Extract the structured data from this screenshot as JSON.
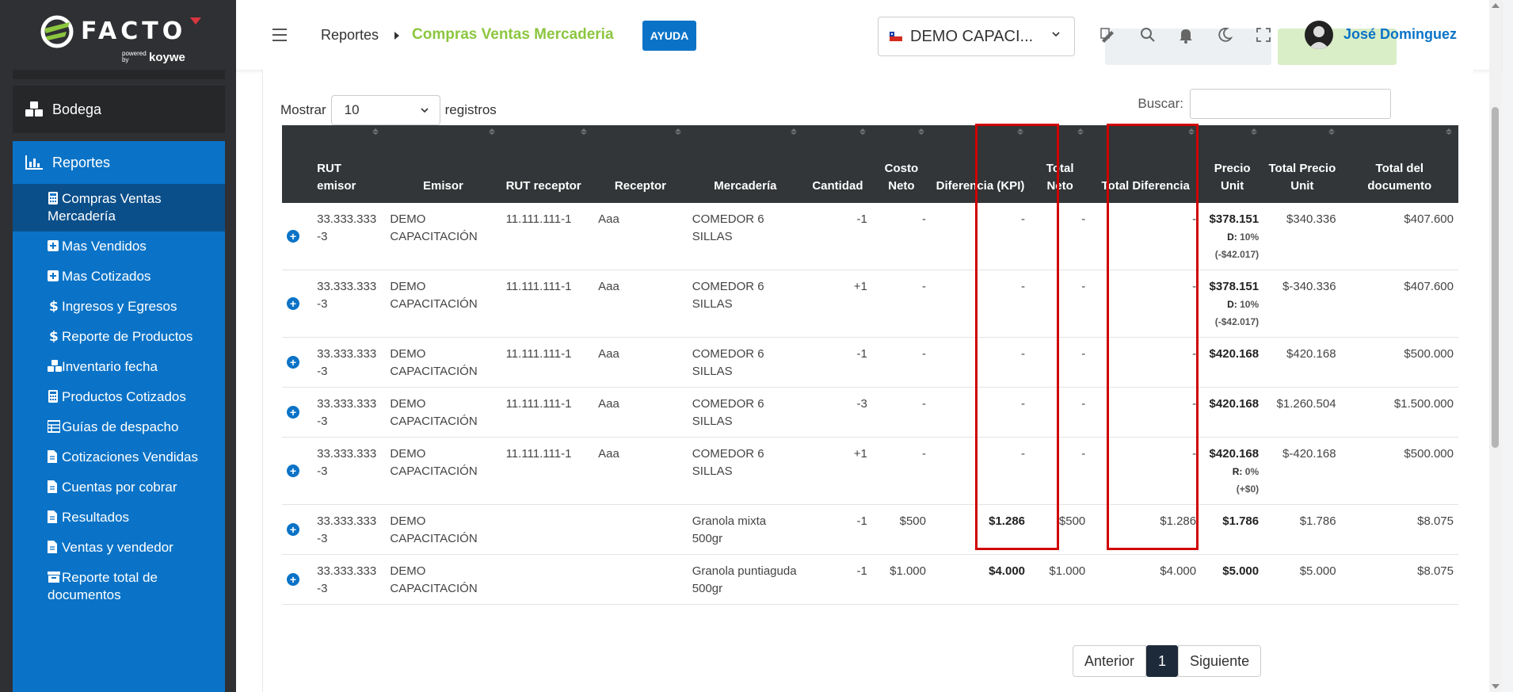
{
  "brand": {
    "name": "FACTO",
    "powered": "powered by",
    "partner": "koywe"
  },
  "sidebar": {
    "bodega": "Bodega",
    "section": "Reportes",
    "items": [
      {
        "label": "Compras Ventas Mercadería",
        "icon": "calculator-icon"
      },
      {
        "label": "Mas Vendidos",
        "icon": "plus-square-icon"
      },
      {
        "label": "Mas Cotizados",
        "icon": "plus-square-icon"
      },
      {
        "label": "Ingresos y Egresos",
        "icon": "dollar-icon"
      },
      {
        "label": "Reporte de Productos",
        "icon": "dollar-icon"
      },
      {
        "label": "Inventario fecha",
        "icon": "cubes-icon"
      },
      {
        "label": "Productos Cotizados",
        "icon": "calculator-icon"
      },
      {
        "label": "Guías de despacho",
        "icon": "table-icon"
      },
      {
        "label": "Cotizaciones Vendidas",
        "icon": "file-icon"
      },
      {
        "label": "Cuentas por cobrar",
        "icon": "file-icon"
      },
      {
        "label": "Resultados",
        "icon": "file-icon"
      },
      {
        "label": "Ventas y vendedor",
        "icon": "file-icon"
      },
      {
        "label": "Reporte total de documentos",
        "icon": "archive-icon"
      }
    ]
  },
  "header": {
    "breadcrumb_parent": "Reportes",
    "breadcrumb_current": "Compras Ventas Mercaderia",
    "help": "AYUDA",
    "company": "DEMO CAPACI...",
    "user": "José Dominguez"
  },
  "table_controls": {
    "show_label": "Mostrar",
    "page_size": "10",
    "records_label": "registros",
    "search_label": "Buscar:"
  },
  "columns": {
    "rut_emisor": "RUT emisor",
    "emisor": "Emisor",
    "rut_receptor": "RUT receptor",
    "receptor": "Receptor",
    "mercaderia": "Mercadería",
    "cantidad": "Cantidad",
    "costo_neto": "Costo Neto",
    "diferencia": "Diferencia (KPI)",
    "total_neto": "Total Neto",
    "total_diferencia": "Total Diferencia",
    "precio_unit": "Precio Unit",
    "total_precio_unit": "Total Precio Unit",
    "total_documento": "Total del documento"
  },
  "rows": [
    {
      "rut_emisor": "33.333.333 -3",
      "emisor": "DEMO CAPACITACIÓN",
      "rut_receptor": "11.111.111-1",
      "receptor": "Aaa",
      "mercaderia": "COMEDOR 6 SILLAS",
      "cantidad": "-1",
      "costo_neto": "-",
      "diferencia": "-",
      "total_neto": "-",
      "total_diferencia": "-",
      "precio_unit": "$378.151",
      "precio_sub1": "D:",
      "precio_sub2": "10%",
      "precio_sub3": "(-$42.017)",
      "total_precio_unit": "$340.336",
      "total_documento": "$407.600"
    },
    {
      "rut_emisor": "33.333.333 -3",
      "emisor": "DEMO CAPACITACIÓN",
      "rut_receptor": "11.111.111-1",
      "receptor": "Aaa",
      "mercaderia": "COMEDOR 6 SILLAS",
      "cantidad": "+1",
      "costo_neto": "-",
      "diferencia": "-",
      "total_neto": "-",
      "total_diferencia": "-",
      "precio_unit": "$378.151",
      "precio_sub1": "D:",
      "precio_sub2": "10%",
      "precio_sub3": "(-$42.017)",
      "total_precio_unit": "$-340.336",
      "total_documento": "$407.600"
    },
    {
      "rut_emisor": "33.333.333 -3",
      "emisor": "DEMO CAPACITACIÓN",
      "rut_receptor": "11.111.111-1",
      "receptor": "Aaa",
      "mercaderia": "COMEDOR 6 SILLAS",
      "cantidad": "-1",
      "costo_neto": "-",
      "diferencia": "-",
      "total_neto": "-",
      "total_diferencia": "-",
      "precio_unit": "$420.168",
      "total_precio_unit": "$420.168",
      "total_documento": "$500.000"
    },
    {
      "rut_emisor": "33.333.333 -3",
      "emisor": "DEMO CAPACITACIÓN",
      "rut_receptor": "11.111.111-1",
      "receptor": "Aaa",
      "mercaderia": "COMEDOR 6 SILLAS",
      "cantidad": "-3",
      "costo_neto": "-",
      "diferencia": "-",
      "total_neto": "-",
      "total_diferencia": "-",
      "precio_unit": "$420.168",
      "total_precio_unit": "$1.260.504",
      "total_documento": "$1.500.000"
    },
    {
      "rut_emisor": "33.333.333 -3",
      "emisor": "DEMO CAPACITACIÓN",
      "rut_receptor": "11.111.111-1",
      "receptor": "Aaa",
      "mercaderia": "COMEDOR 6 SILLAS",
      "cantidad": "+1",
      "costo_neto": "-",
      "diferencia": "-",
      "total_neto": "-",
      "total_diferencia": "-",
      "precio_unit": "$420.168",
      "precio_sub1": "R:",
      "precio_sub2": "0%",
      "precio_sub3": "(+$0)",
      "total_precio_unit": "$-420.168",
      "total_documento": "$500.000"
    },
    {
      "rut_emisor": "33.333.333 -3",
      "emisor": "DEMO CAPACITACIÓN",
      "rut_receptor": "",
      "receptor": "",
      "mercaderia": "Granola mixta 500gr",
      "cantidad": "-1",
      "costo_neto": "$500",
      "diferencia": "$1.286",
      "total_neto": "$500",
      "total_diferencia": "$1.286",
      "precio_unit": "$1.786",
      "total_precio_unit": "$1.786",
      "total_documento": "$8.075"
    },
    {
      "rut_emisor": "33.333.333 -3",
      "emisor": "DEMO CAPACITACIÓN",
      "rut_receptor": "",
      "receptor": "",
      "mercaderia": "Granola puntiaguda 500gr",
      "cantidad": "-1",
      "costo_neto": "$1.000",
      "diferencia": "$4.000",
      "total_neto": "$1.000",
      "total_diferencia": "$4.000",
      "precio_unit": "$5.000",
      "total_precio_unit": "$5.000",
      "total_documento": "$8.075"
    }
  ],
  "pagination": {
    "prev": "Anterior",
    "current": "1",
    "next": "Siguiente"
  },
  "colors": {
    "brand_blue": "#0a73c7",
    "brand_green": "#8cc63f",
    "header_dark": "#323638",
    "highlight_red": "#d00000"
  }
}
